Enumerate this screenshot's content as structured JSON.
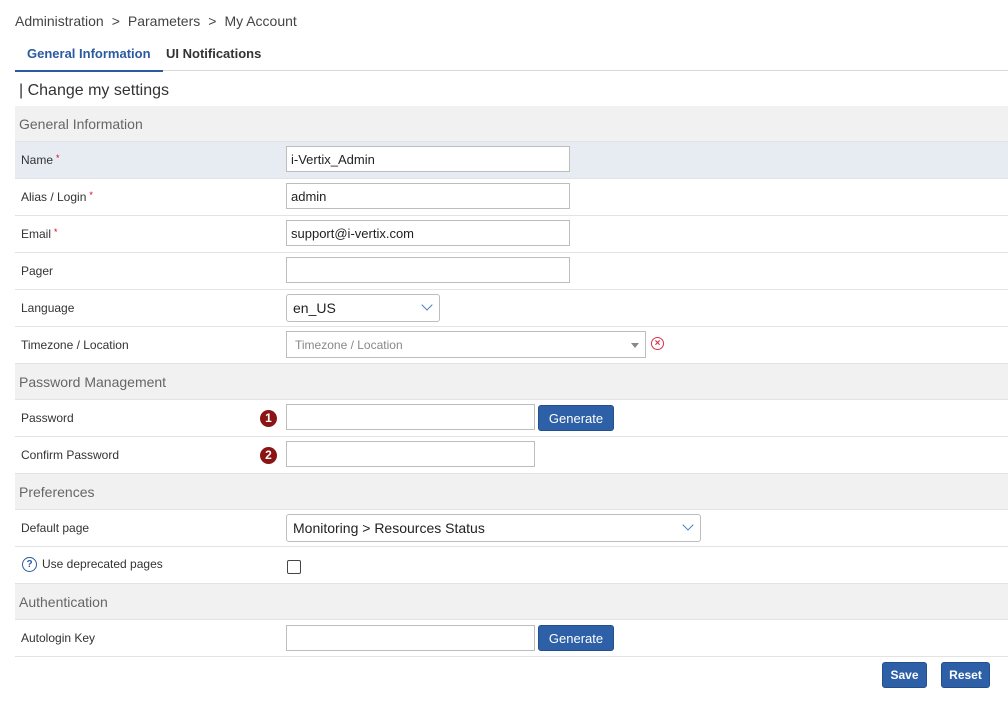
{
  "breadcrumb": {
    "items": [
      "Administration",
      "Parameters",
      "My Account"
    ],
    "separator": ">"
  },
  "tabs": [
    {
      "label": "General Information",
      "active": true
    },
    {
      "label": "UI Notifications",
      "active": false
    }
  ],
  "page_title": "| Change my settings",
  "sections": {
    "general": {
      "title": "General Information",
      "name": {
        "label": "Name",
        "value": "i-Vertix_Admin",
        "required": "*"
      },
      "alias": {
        "label": "Alias / Login",
        "value": "admin",
        "required": "*"
      },
      "email": {
        "label": "Email",
        "value": "support@i-vertix.com",
        "required": "*"
      },
      "pager": {
        "label": "Pager",
        "value": ""
      },
      "language": {
        "label": "Language",
        "selected": "en_US"
      },
      "timezone": {
        "label": "Timezone / Location",
        "placeholder": "Timezone / Location",
        "clear_icon": "circle-x-icon"
      }
    },
    "password": {
      "title": "Password Management",
      "password": {
        "label": "Password",
        "badge": "1",
        "generate_label": "Generate"
      },
      "confirm": {
        "label": "Confirm Password",
        "badge": "2"
      }
    },
    "preferences": {
      "title": "Preferences",
      "default_page": {
        "label": "Default page",
        "selected": "Monitoring > Resources Status"
      },
      "deprecated": {
        "label": "Use deprecated pages",
        "checked": false,
        "help_icon": "question-circle-icon"
      }
    },
    "authentication": {
      "title": "Authentication",
      "autologin": {
        "label": "Autologin Key",
        "value": "",
        "generate_label": "Generate"
      }
    }
  },
  "actions": {
    "save_label": "Save",
    "reset_label": "Reset"
  },
  "colors": {
    "accent": "#2e60a8",
    "badge": "#8b1414",
    "required": "#d9001b",
    "highlight_row": "#e7ecf3",
    "section_bg": "#f1f1f1"
  }
}
